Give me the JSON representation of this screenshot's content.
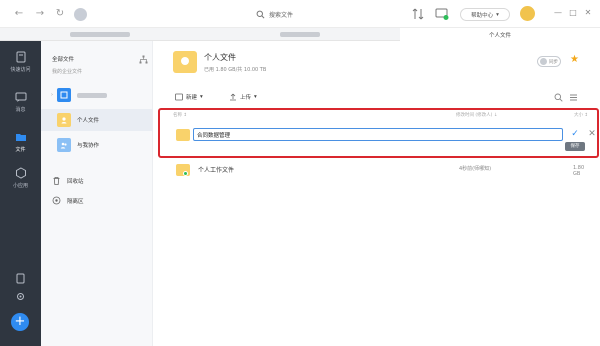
{
  "titlebar": {
    "search_placeholder": "搜索文件",
    "help_label": "帮助中心",
    "help_caret": "▾"
  },
  "tabs": [
    {
      "label": ""
    },
    {
      "label": ""
    },
    {
      "label": "个人文件"
    }
  ],
  "rail": {
    "items": [
      {
        "label": "快速访问"
      },
      {
        "label": "消息"
      },
      {
        "label": "文件"
      },
      {
        "label": "小应用"
      }
    ],
    "add_label": "+"
  },
  "sidebar": {
    "title": "全部文件",
    "subtitle": "我的企业文件",
    "tree": [
      {
        "label": ""
      },
      {
        "label": "个人文件"
      },
      {
        "label": "与我协作"
      }
    ],
    "links": [
      {
        "label": "回收站"
      },
      {
        "label": "隔离区"
      }
    ]
  },
  "main": {
    "title": "个人文件",
    "quota": "已用 1.80 GB/共 10.00 TB",
    "sync_label": "同步",
    "toolbar": {
      "new_label": "新建",
      "upload_label": "上传",
      "caret": "▾"
    },
    "columns": {
      "name": "名称 ↕",
      "modified": "修改时间 (修改人) ↓",
      "size": "大小 ↕"
    },
    "edit_row": {
      "value": "合同数据管理",
      "save_tip": "保存"
    },
    "files": [
      {
        "name": "个人工作文件",
        "time": "4秒前(师哪知)",
        "size": "1.80 GB"
      }
    ]
  },
  "colors": {
    "accent": "#2f8bf0",
    "folder": "#f9d26b",
    "highlight": "#d9272e",
    "rail_bg": "#2f3640"
  }
}
